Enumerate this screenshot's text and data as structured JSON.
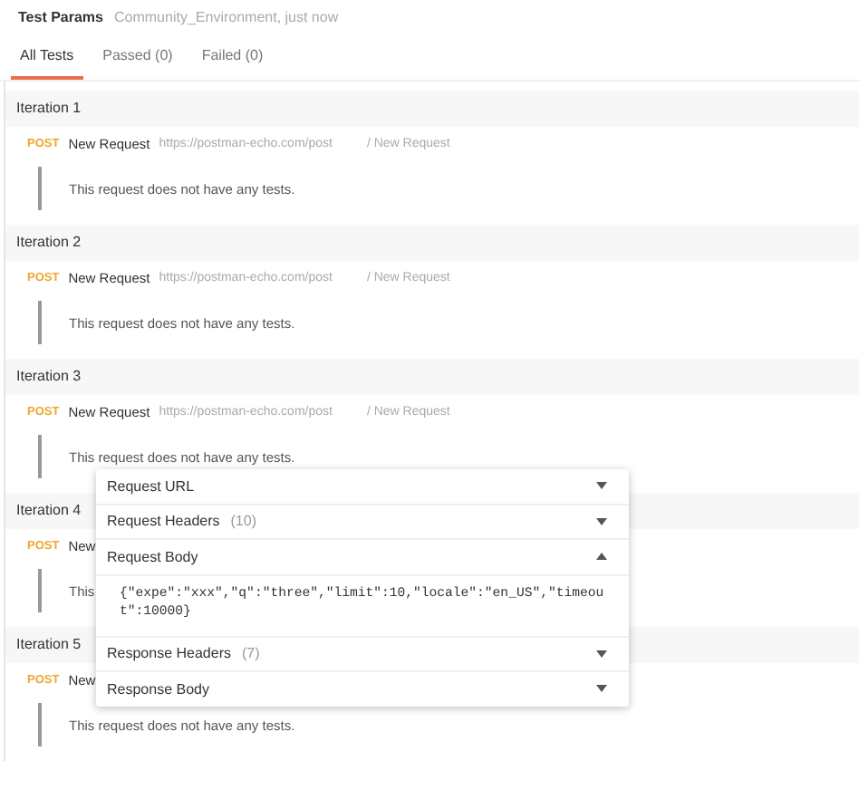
{
  "header": {
    "title": "Test Params",
    "subtitle": "Community_Environment, just now"
  },
  "tabs": [
    {
      "label": "All Tests",
      "selected": true
    },
    {
      "label": "Passed (0)",
      "selected": false
    },
    {
      "label": "Failed (0)",
      "selected": false
    }
  ],
  "iterations": [
    {
      "title": "Iteration 1",
      "method": "POST",
      "name": "New Request",
      "url": "https://postman-echo.com/post",
      "path": "/ New Request",
      "message": "This request does not have any tests."
    },
    {
      "title": "Iteration 2",
      "method": "POST",
      "name": "New Request",
      "url": "https://postman-echo.com/post",
      "path": "/ New Request",
      "message": "This request does not have any tests."
    },
    {
      "title": "Iteration 3",
      "method": "POST",
      "name": "New Request",
      "url": "https://postman-echo.com/post",
      "path": "/ New Request",
      "message": "This request does not have any tests."
    },
    {
      "title": "Iteration 4",
      "method": "POST",
      "name": "New",
      "message": "This"
    },
    {
      "title": "Iteration 5",
      "method": "POST",
      "name": "New",
      "message": "This request does not have any tests."
    }
  ],
  "popup": {
    "sections": [
      {
        "label": "Request URL",
        "expanded": false
      },
      {
        "label": "Request Headers",
        "count": "(10)",
        "expanded": false
      },
      {
        "label": "Request Body",
        "expanded": true,
        "body": "{\"expe\":\"xxx\",\"q\":\"three\",\"limit\":10,\"locale\":\"en_US\",\"timeout\":10000}"
      },
      {
        "label": "Response Headers",
        "count": "(7)",
        "expanded": false
      },
      {
        "label": "Response Body",
        "expanded": false
      }
    ]
  }
}
